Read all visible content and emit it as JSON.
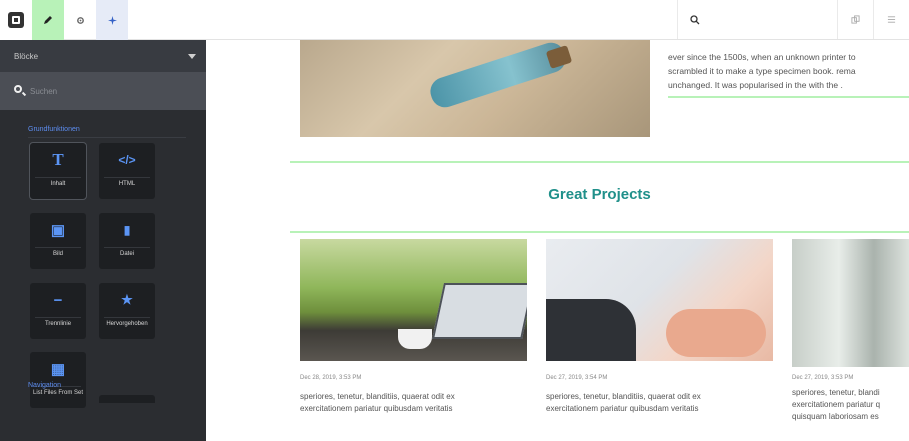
{
  "toolbar": {
    "search_icon": "search-icon",
    "colors": {
      "edit_active": "#b8f2b8",
      "selected": "#e6ebf7",
      "accent": "#3461c6"
    }
  },
  "sidebar": {
    "dropdown_label": "Blöcke",
    "search_placeholder": "Suchen",
    "section1": "Grundfunktionen",
    "section2": "Navigation",
    "tiles": [
      {
        "label": "Inhalt",
        "icon": "text-icon",
        "glyph": "T"
      },
      {
        "label": "HTML",
        "icon": "code-icon",
        "glyph": "</>"
      },
      {
        "label": "Bild",
        "icon": "image-icon",
        "glyph": "▣"
      },
      {
        "label": "Datei",
        "icon": "file-icon",
        "glyph": "▮"
      },
      {
        "label": "Trennlinie",
        "icon": "divider-icon",
        "glyph": "−"
      },
      {
        "label": "Hervorgehoben",
        "icon": "star-icon",
        "glyph": "★"
      },
      {
        "label": "List Files From Set",
        "icon": "list-files-icon",
        "glyph": "▦"
      }
    ]
  },
  "main": {
    "hero_text": [
      "ever since the 1500s, when an unknown printer to",
      "scrambled it to make a type specimen book. rema",
      "unchanged. It was popularised in the with the ."
    ],
    "section_title": "Great Projects",
    "accent_color": "#20908a",
    "cards": [
      {
        "date": "Dec 28, 2019, 3:53 PM",
        "text": [
          "speriores, tenetur, blanditiis, quaerat odit ex",
          "exercitationem pariatur quibusdam veritatis"
        ]
      },
      {
        "date": "Dec 27, 2019, 3:54 PM",
        "text": [
          "speriores, tenetur, blanditiis, quaerat odit ex",
          "exercitationem pariatur quibusdam veritatis"
        ]
      },
      {
        "date": "Dec 27, 2019, 3:53 PM",
        "text": [
          "speriores, tenetur, blandi",
          "exercitationem pariatur q",
          "quisquam laboriosam es"
        ]
      }
    ]
  }
}
